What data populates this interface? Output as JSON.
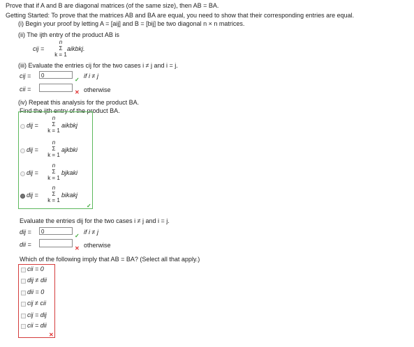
{
  "problem": "Prove that if A and B are diagonal matrices (of the same size), then AB = BA.",
  "getting_started": "Getting Started: To prove that the matrices AB and BA are equal, you need to show that their corresponding entries are equal.",
  "step_i": "(i) Begin your proof by letting A = [aij] and B = [bij] be two diagonal n × n matrices.",
  "step_ii": "(ii) The ijth entry of the product AB is",
  "formula_c": {
    "lhs": "cij =",
    "upper": "n",
    "sigma": "Σ",
    "lower": "k = 1",
    "term": "aikbkj."
  },
  "step_iii": "(iii) Evaluate the entries cij for the two cases i ≠ j and i = j.",
  "c_cases": {
    "row1_label": "cij =",
    "row1_value": "0",
    "row1_cond": "if i ≠ j",
    "row2_label": "cii =",
    "row2_value": "",
    "row2_cond": "otherwise"
  },
  "step_iv": "(iv) Repeat this analysis for the product BA.",
  "find_text": "Find the ijth entry of the product BA.",
  "options_d": [
    {
      "lhs": "dij =",
      "upper": "n",
      "sigma": "Σ",
      "lower": "k = 1",
      "term": "aikbkj",
      "selected": false
    },
    {
      "lhs": "dij =",
      "upper": "n",
      "sigma": "Σ",
      "lower": "k = 1",
      "term": "ajkbki",
      "selected": false
    },
    {
      "lhs": "dij =",
      "upper": "n",
      "sigma": "Σ",
      "lower": "k = 1",
      "term": "bjkaki",
      "selected": false
    },
    {
      "lhs": "dij =",
      "upper": "n",
      "sigma": "Σ",
      "lower": "k = 1",
      "term": "bikakj",
      "selected": true
    }
  ],
  "evaluate_d": "Evaluate the entries dij for the two cases i ≠ j and i = j.",
  "d_cases": {
    "row1_label": "dij =",
    "row1_value": "0",
    "row1_cond": "if i ≠ j",
    "row2_label": "dii =",
    "row2_value": "",
    "row2_cond": "otherwise"
  },
  "which_question": "Which of the following imply that AB = BA? (Select all that apply.)",
  "checkbox_options": [
    "cii = 0",
    "dij ≠ dii",
    "dii = 0",
    "cij ≠ cii",
    "cij = dij",
    "cii = dii"
  ],
  "marks": {
    "check": "✓",
    "cross": "✕"
  },
  "colors": {
    "correct": "#3aa635",
    "incorrect": "#e03030",
    "green_border": "#5cb85c",
    "red_border": "#d43c3c"
  }
}
